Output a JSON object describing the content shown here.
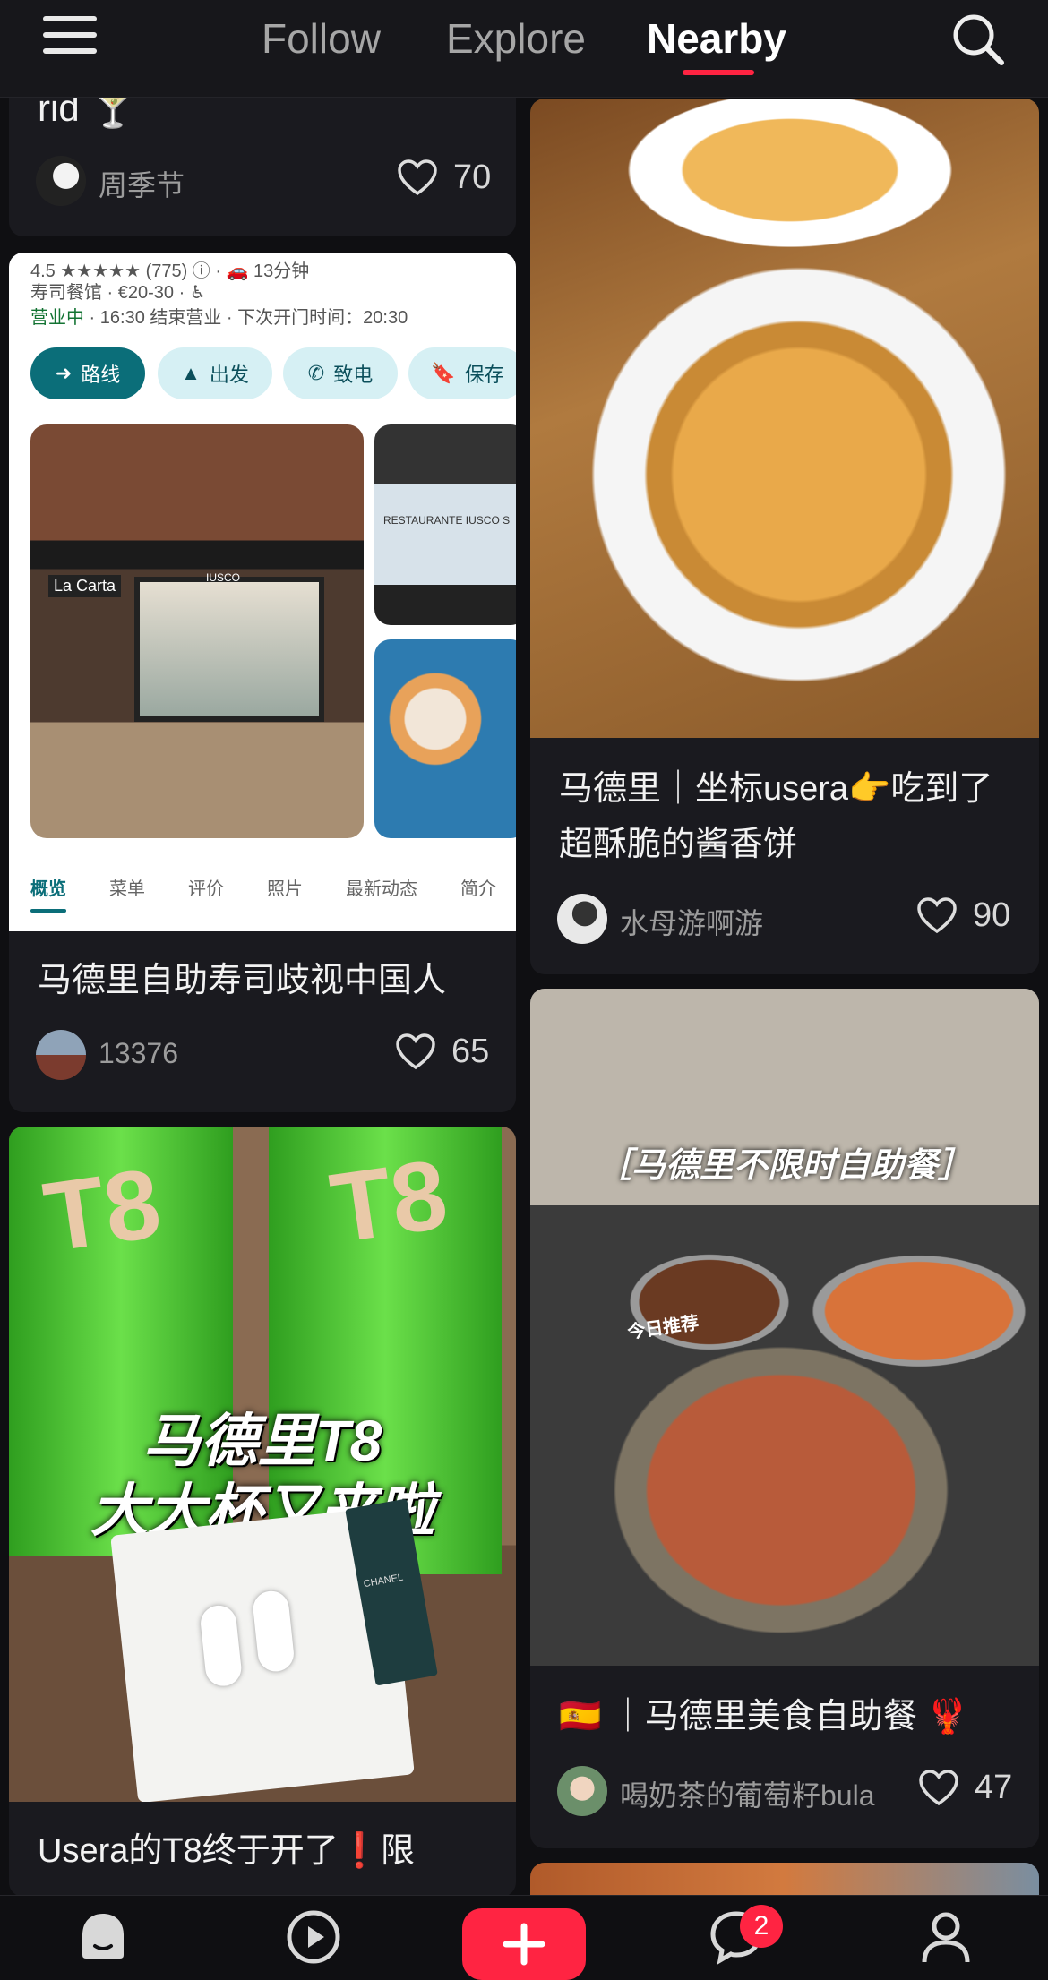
{
  "header": {
    "tabs": [
      {
        "label": "Follow"
      },
      {
        "label": "Explore"
      },
      {
        "label": "Nearby"
      }
    ],
    "active_tab": "Nearby"
  },
  "cards": {
    "c1": {
      "title_tail": "rid 🍸",
      "author": "周季节",
      "likes": "70"
    },
    "c2": {
      "title": "马德里自助寿司歧视中国人",
      "author": "13376",
      "likes": "65",
      "maps": {
        "line1": "4.5 ★★★★★ (775) ⓘ · 🚗 13分钟",
        "line2": "寿司餐馆 · €20-30 · ♿",
        "line3_open": "营业中",
        "line3_rest": " · 16:30 结束营业 · 下次开门时间：20:30",
        "buttons": [
          "路线",
          "出发",
          "致电",
          "保存"
        ],
        "tabs": [
          "概览",
          "菜单",
          "评价",
          "照片",
          "最新动态",
          "简介"
        ],
        "sign_left": "La Carta",
        "sign_door": "IUSCO",
        "side_sign": "RESTAURANTE IUSCO S"
      }
    },
    "c3": {
      "title": "Usera的T8终于开了❗限",
      "overlay_line1": "马德里T8",
      "overlay_line2": "大大杯又来啦",
      "cup_text": "T8",
      "box_text": "CHANEL"
    },
    "c4": {
      "title": "马德里｜坐标usera👉吃到了超酥脆的酱香饼",
      "author": "水母游啊游",
      "likes": "90"
    },
    "c5": {
      "title": "🇪🇸 ｜马德里美食自助餐 🦞",
      "author": "喝奶茶的葡萄籽bula",
      "likes": "47",
      "overlay": "［马德里不限时自助餐］",
      "sticker": "今日推荐"
    }
  },
  "bottom_nav": {
    "items": [
      "home-icon",
      "video-icon",
      "plus-icon",
      "message-icon",
      "profile-icon"
    ],
    "message_badge": "2"
  },
  "colors": {
    "accent": "#ff2442",
    "maps_teal": "#0b6e79",
    "background": "#0f0f12"
  }
}
